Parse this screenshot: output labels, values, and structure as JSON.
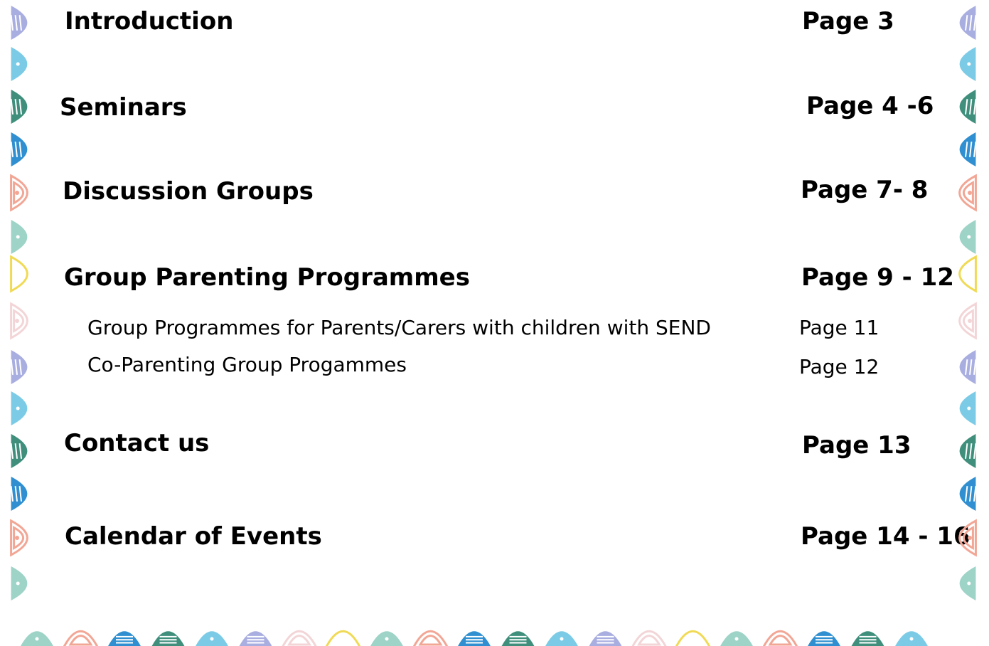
{
  "toc": {
    "entries": [
      {
        "label": "Introduction",
        "page": "Page 3"
      },
      {
        "label": "Seminars",
        "page": "Page 4 -6"
      },
      {
        "label": "Discussion Groups",
        "page": "Page 7- 8"
      },
      {
        "label": "Group Parenting Programmes",
        "page": "Page 9 - 12"
      },
      {
        "label": "Contact us",
        "page": "Page 13"
      },
      {
        "label": "Calendar of Events",
        "page": "Page 14 - 16"
      }
    ],
    "subentries": [
      {
        "label": "Group Programmes for Parents/Carers with children with SEND",
        "page": "Page 11"
      },
      {
        "label": "Co-Parenting Group Progammes",
        "page": "Page 12"
      }
    ]
  },
  "decor": {
    "palette": [
      "#a9aee0",
      "#7ccbe6",
      "#3f8f7c",
      "#2f8fd0",
      "#f2a695",
      "#9ed3c7",
      "#f0da55",
      "#f3d5d7"
    ]
  }
}
